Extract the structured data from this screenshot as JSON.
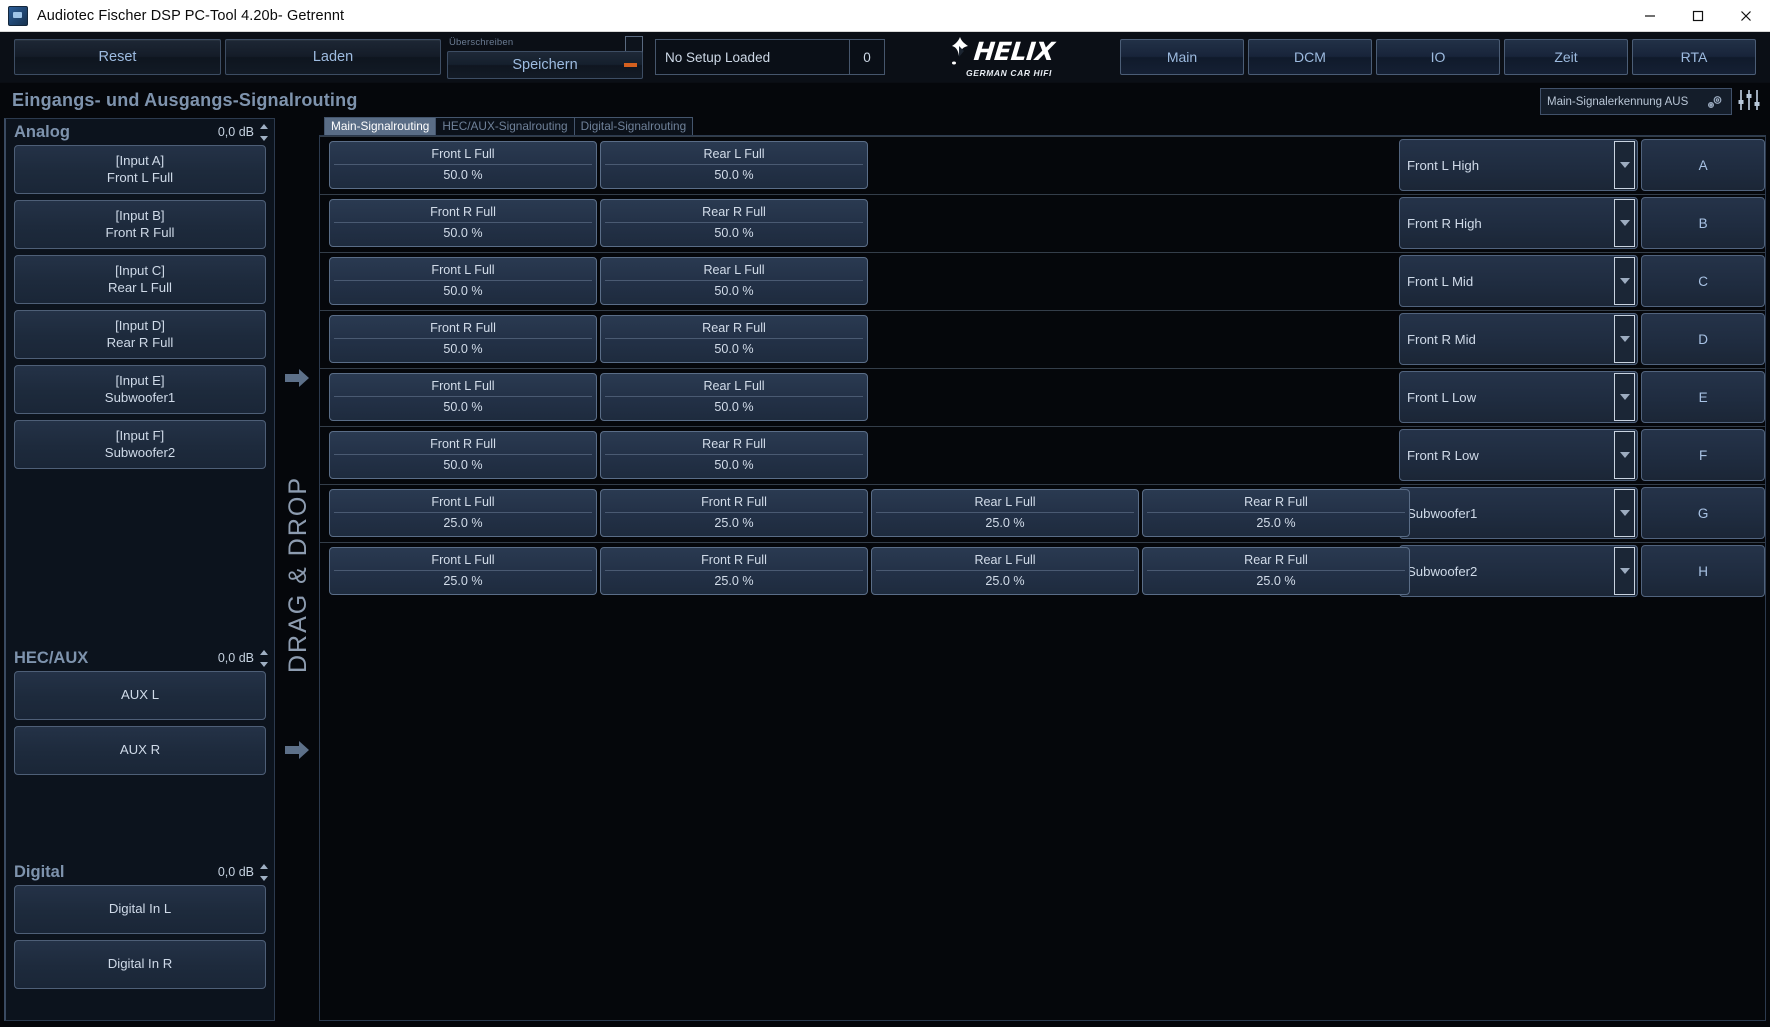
{
  "window": {
    "title": "Audiotec Fischer DSP PC-Tool 4.20b- Getrennt",
    "minimize": "minimize-icon",
    "maximize": "maximize-icon",
    "close": "close-icon"
  },
  "toolbar": {
    "reset_label": "Reset",
    "laden_label": "Laden",
    "overwrite_label": "Überschreiben",
    "speichern_label": "Speichern",
    "setup_name": "No Setup Loaded",
    "setup_number": "0",
    "logo_text": "HELIX",
    "logo_sub": "GERMAN CAR HIFI",
    "nav": [
      {
        "label": "Main"
      },
      {
        "label": "DCM"
      },
      {
        "label": "IO"
      },
      {
        "label": "Zeit"
      },
      {
        "label": "RTA"
      }
    ]
  },
  "page": {
    "title": "Eingangs- und Ausgangs-Signalrouting",
    "status_text": "Main-Signalerkennung AUS"
  },
  "tabs": [
    {
      "label": "Main-Signalrouting",
      "active": true
    },
    {
      "label": "HEC/AUX-Signalrouting",
      "active": false
    },
    {
      "label": "Digital-Signalrouting",
      "active": false
    }
  ],
  "drag_drop_label": "DRAG & DROP",
  "inputs": {
    "analog": {
      "title": "Analog",
      "db": "0,0 dB",
      "items": [
        {
          "tag": "[Input A]",
          "name": "Front L Full"
        },
        {
          "tag": "[Input B]",
          "name": "Front R Full"
        },
        {
          "tag": "[Input C]",
          "name": "Rear L Full"
        },
        {
          "tag": "[Input D]",
          "name": "Rear R Full"
        },
        {
          "tag": "[Input E]",
          "name": "Subwoofer1"
        },
        {
          "tag": "[Input F]",
          "name": "Subwoofer2"
        }
      ]
    },
    "hecaux": {
      "title": "HEC/AUX",
      "db": "0,0 dB",
      "items": [
        {
          "tag": "",
          "name": "AUX L"
        },
        {
          "tag": "",
          "name": "AUX R"
        }
      ]
    },
    "digital": {
      "title": "Digital",
      "db": "0,0 dB",
      "items": [
        {
          "tag": "",
          "name": "Digital In L"
        },
        {
          "tag": "",
          "name": "Digital In R"
        }
      ]
    }
  },
  "routing_rows": [
    {
      "cells": [
        {
          "name": "Front L Full",
          "value": "50.0 %"
        },
        {
          "name": "Rear L Full",
          "value": "50.0 %"
        }
      ],
      "output": {
        "name": "Front L High",
        "channel": "A"
      }
    },
    {
      "cells": [
        {
          "name": "Front R Full",
          "value": "50.0 %"
        },
        {
          "name": "Rear R Full",
          "value": "50.0 %"
        }
      ],
      "output": {
        "name": "Front R High",
        "channel": "B"
      }
    },
    {
      "cells": [
        {
          "name": "Front L Full",
          "value": "50.0 %"
        },
        {
          "name": "Rear L Full",
          "value": "50.0 %"
        }
      ],
      "output": {
        "name": "Front L Mid",
        "channel": "C"
      }
    },
    {
      "cells": [
        {
          "name": "Front R Full",
          "value": "50.0 %"
        },
        {
          "name": "Rear R Full",
          "value": "50.0 %"
        }
      ],
      "output": {
        "name": "Front R Mid",
        "channel": "D"
      }
    },
    {
      "cells": [
        {
          "name": "Front L Full",
          "value": "50.0 %"
        },
        {
          "name": "Rear L Full",
          "value": "50.0 %"
        }
      ],
      "output": {
        "name": "Front L Low",
        "channel": "E"
      }
    },
    {
      "cells": [
        {
          "name": "Front R Full",
          "value": "50.0 %"
        },
        {
          "name": "Rear R Full",
          "value": "50.0 %"
        }
      ],
      "output": {
        "name": "Front R Low",
        "channel": "F"
      }
    },
    {
      "cells": [
        {
          "name": "Front L Full",
          "value": "25.0 %"
        },
        {
          "name": "Front R Full",
          "value": "25.0 %"
        },
        {
          "name": "Rear L Full",
          "value": "25.0 %"
        },
        {
          "name": "Rear R Full",
          "value": "25.0 %"
        }
      ],
      "output": {
        "name": "Subwoofer1",
        "channel": "G"
      }
    },
    {
      "cells": [
        {
          "name": "Front L Full",
          "value": "25.0 %"
        },
        {
          "name": "Front R Full",
          "value": "25.0 %"
        },
        {
          "name": "Rear L Full",
          "value": "25.0 %"
        },
        {
          "name": "Rear R Full",
          "value": "25.0 %"
        }
      ],
      "output": {
        "name": "Subwoofer2",
        "channel": "H"
      }
    }
  ],
  "colors": {
    "accent_orange": "#d4601f",
    "panel_blue": "#233147",
    "border_blue": "#5a6d87",
    "text_blue": "#9dbbe0",
    "heading": "#7e93ad"
  }
}
